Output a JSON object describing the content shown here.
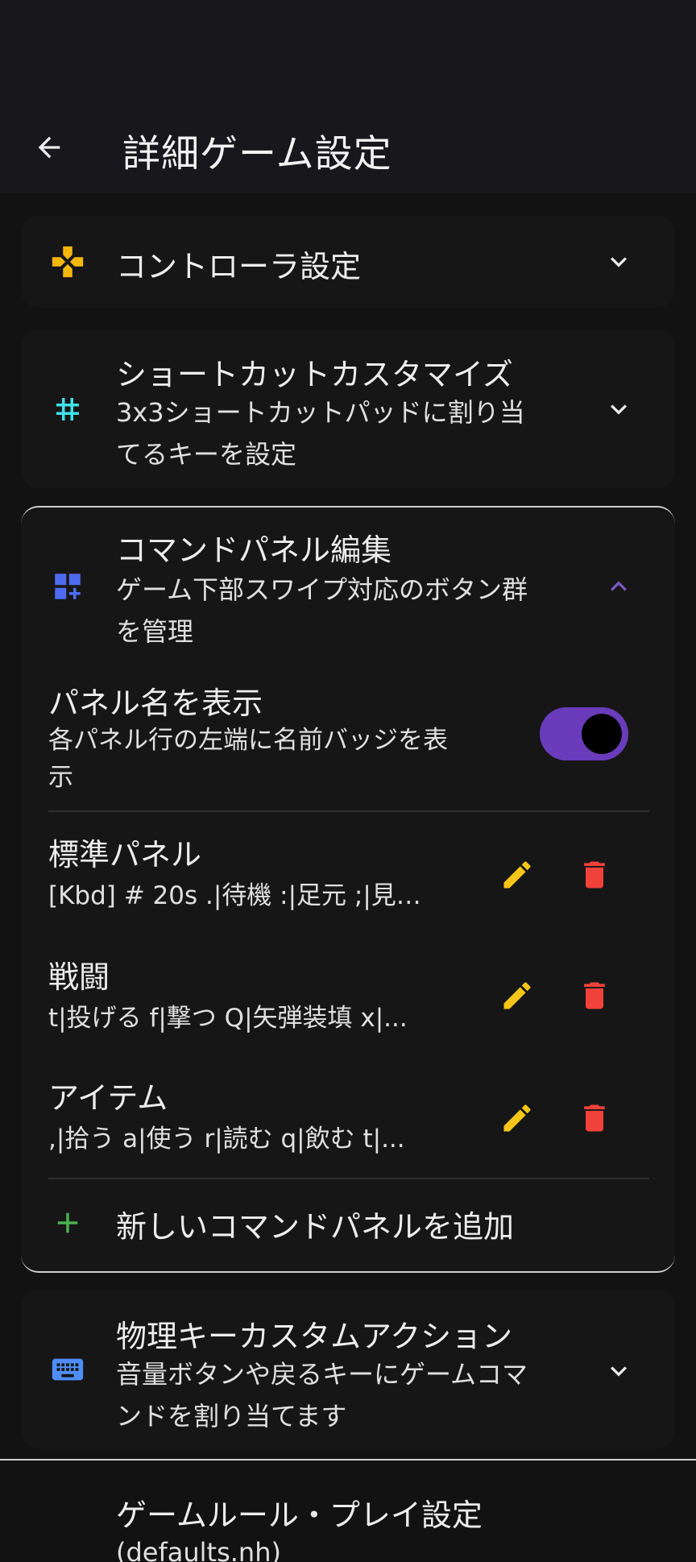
{
  "app_bar": {
    "title": "詳細ゲーム設定",
    "back_icon": "arrow-back-icon"
  },
  "sections": {
    "controller": {
      "title": "コントローラ設定",
      "icon": "gamepad-icon",
      "icon_color": "#F5B70A",
      "expanded": false
    },
    "shortcut": {
      "title": "ショートカットカスタマイズ",
      "subtitle_line1": "3x3ショートカットパッドに割り当",
      "subtitle_line2": "てるキーを設定",
      "icon": "hash-icon",
      "icon_color": "#3FE3E8",
      "expanded": false
    },
    "command_panel": {
      "title": "コマンドパネル編集",
      "subtitle_line1": "ゲーム下部スワイプ対応のボタン群",
      "subtitle_line2": "を管理",
      "icon": "dashboard-add-icon",
      "icon_color": "#4E6BF0",
      "expanded": true,
      "show_name": {
        "title": "パネル名を表示",
        "subtitle_line1": "各パネル行の左端に名前バッジを表",
        "subtitle_line2": "示",
        "enabled": true
      },
      "panels": [
        {
          "name": "標準パネル",
          "summary": "[Kbd] # 20s .|待機 :|足元 ;|見…"
        },
        {
          "name": "戦闘",
          "summary": "t|投げる f|撃つ Q|矢弾装填 x|..."
        },
        {
          "name": "アイテム",
          "summary": ",|拾う a|使う r|読む q|飲む t|..."
        }
      ],
      "add_label": "新しいコマンドパネルを追加"
    },
    "physical_keys": {
      "title": "物理キーカスタムアクション",
      "subtitle_line1": "音量ボタンや戻るキーにゲームコマ",
      "subtitle_line2": "ンドを割り当てます",
      "icon": "keyboard-icon",
      "icon_color": "#4F8EF7",
      "expanded": false
    },
    "game_rules": {
      "title": "ゲームルール・プレイ設定",
      "subtitle": "(defaults.nh)"
    }
  },
  "colors": {
    "edit": "#F5C518",
    "delete": "#F0413A",
    "add": "#4CAF50",
    "accent": "#6A3CBC"
  }
}
